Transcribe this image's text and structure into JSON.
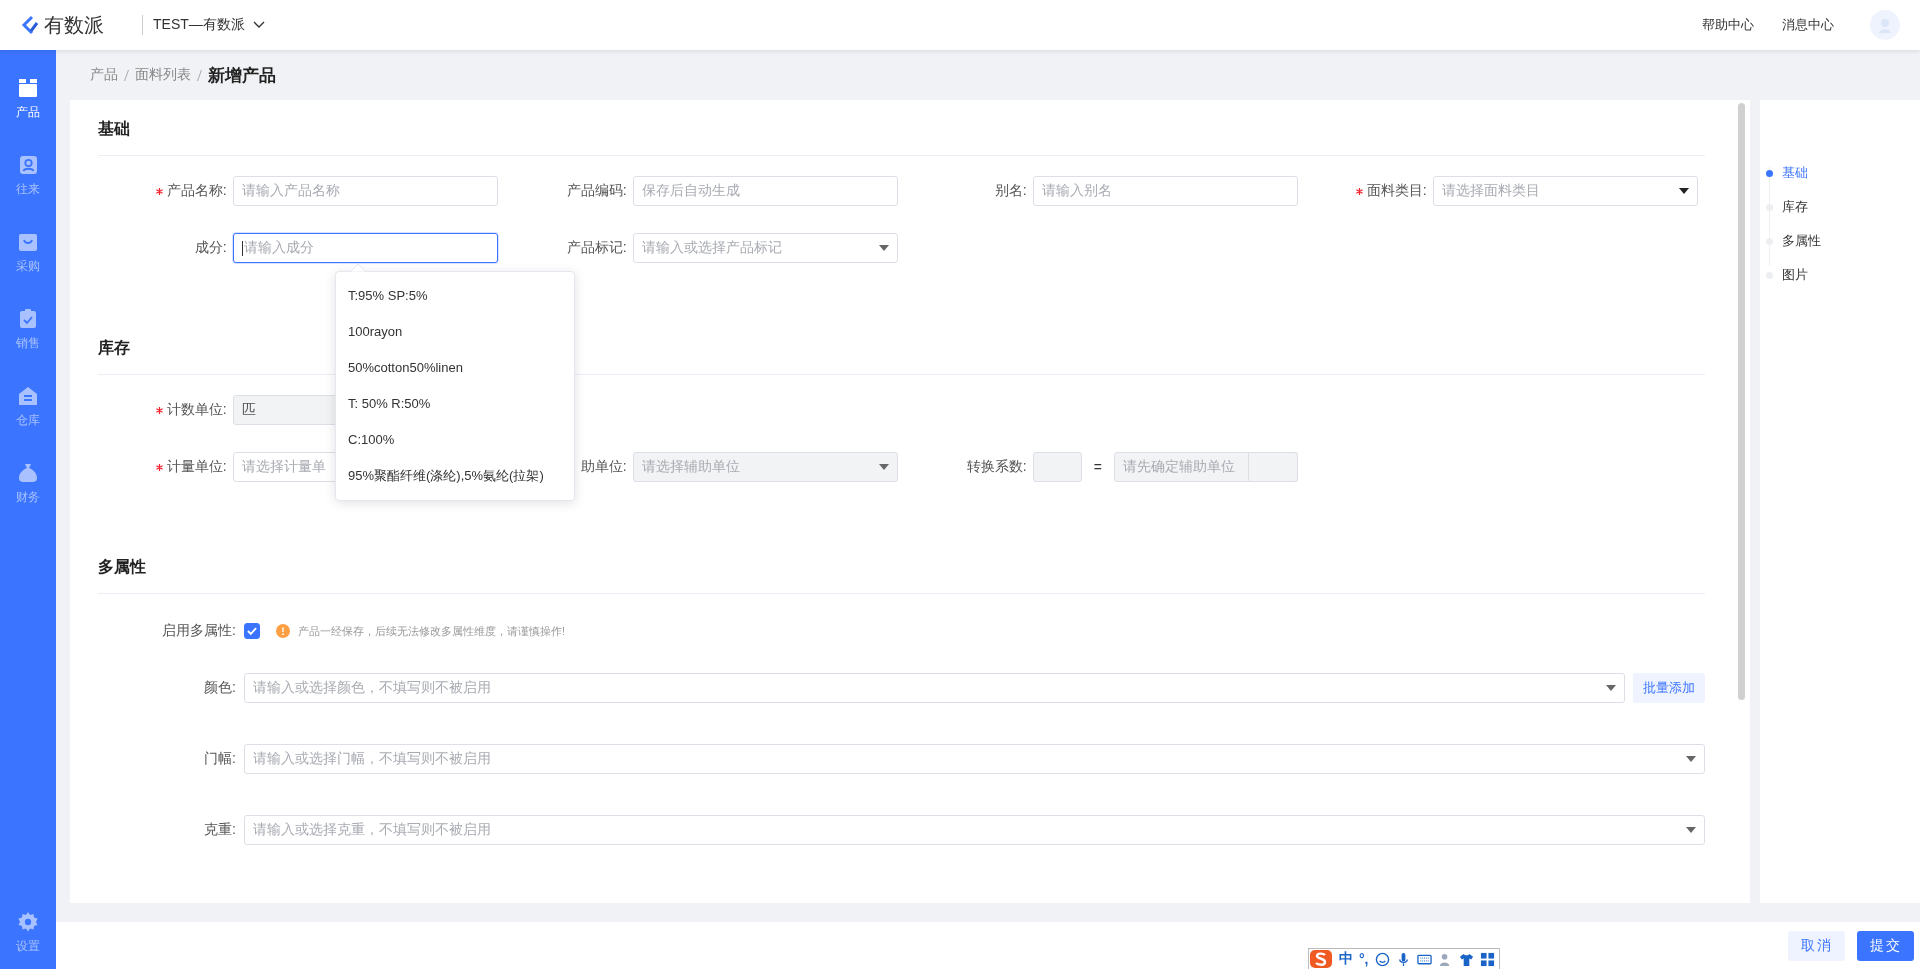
{
  "brand": {
    "name": "有数派"
  },
  "org": {
    "name": "TEST—有数派"
  },
  "header_links": [
    "帮助中心",
    "消息中心"
  ],
  "sidebar": {
    "items": [
      {
        "label": "产品",
        "selected": true
      },
      {
        "label": "往来",
        "selected": false
      },
      {
        "label": "采购",
        "selected": false
      },
      {
        "label": "销售",
        "selected": false
      },
      {
        "label": "仓库",
        "selected": false
      },
      {
        "label": "财务",
        "selected": false
      }
    ],
    "settings": {
      "label": "设置"
    }
  },
  "breadcrumb": [
    "产品",
    "面料列表",
    "新增产品"
  ],
  "basic": {
    "title": "基础",
    "fields": [
      {
        "label": "产品名称:",
        "required": true,
        "kind": "input",
        "placeholder": "请输入产品名称",
        "focused": false
      },
      {
        "label": "产品编码:",
        "required": false,
        "kind": "input",
        "placeholder": "保存后自动生成",
        "focused": false
      },
      {
        "label": "别名:",
        "required": false,
        "kind": "input",
        "placeholder": "请输入别名",
        "focused": false
      },
      {
        "label": "面料类目:",
        "required": true,
        "kind": "select",
        "placeholder": "请选择面料类目",
        "focused": false
      },
      {
        "label": "成分:",
        "required": false,
        "kind": "input",
        "placeholder": "请输入成分",
        "focused": true,
        "suggestions": [
          "T:95% SP:5%",
          "100rayon",
          "50%cotton50%linen",
          "T: 50% R:50%",
          "C:100%",
          "95%聚酯纤维(涤纶),5%氨纶(拉架)"
        ]
      },
      {
        "label": "产品标记:",
        "required": false,
        "kind": "combo",
        "placeholder": "请输入或选择产品标记",
        "focused": false
      }
    ]
  },
  "inventory": {
    "title": "库存",
    "fields": [
      {
        "label": "计数单位:",
        "required": true,
        "kind": "input",
        "value": "匹",
        "disabled": true
      },
      {
        "label": "计量单位:",
        "required": true,
        "kind": "input",
        "placeholder": "请选择计量单",
        "disabled": false
      },
      {
        "label": "助单位:",
        "required": false,
        "kind": "combo",
        "placeholder": "请选择辅助单位",
        "disabled": true
      },
      {
        "label": "转换系数:",
        "required": false,
        "kind": "ratio",
        "equals": "=",
        "placeholder": "请先确定辅助单位",
        "disabled": true
      }
    ]
  },
  "multi": {
    "title": "多属性",
    "enable_label": "启用多属性:",
    "enabled": true,
    "warning": "产品一经保存，后续无法修改多属性维度，请谨慎操作!",
    "attributes": [
      {
        "label": "颜色:",
        "placeholder": "请输入或选择颜色，不填写则不被启用",
        "action": "批量添加"
      },
      {
        "label": "门幅:",
        "placeholder": "请输入或选择门幅，不填写则不被启用"
      },
      {
        "label": "克重:",
        "placeholder": "请输入或选择克重，不填写则不被启用"
      }
    ]
  },
  "anchors": [
    {
      "label": "基础",
      "selected": true
    },
    {
      "label": "库存",
      "selected": false
    },
    {
      "label": "多属性",
      "selected": false
    },
    {
      "label": "图片",
      "selected": false
    }
  ],
  "ime": {
    "mode": "中",
    "punctuation": "°,"
  },
  "buttons": [
    {
      "label": "取消",
      "kind": "secondary"
    },
    {
      "label": "提交",
      "kind": "primary"
    }
  ]
}
